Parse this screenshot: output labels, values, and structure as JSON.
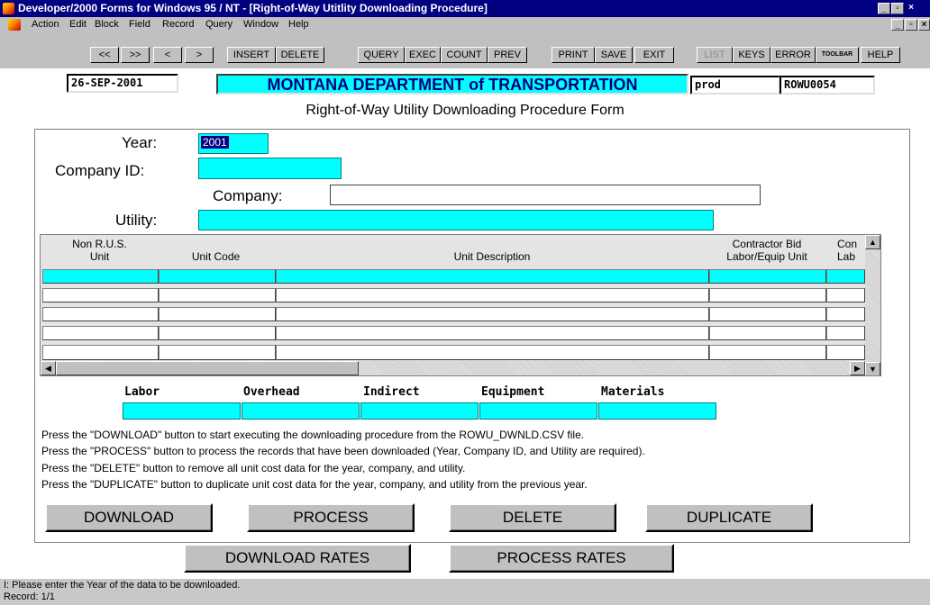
{
  "window": {
    "title": "Developer/2000 Forms for Windows 95 / NT  - [Right-of-Way Utitlity Downloading Procedure]",
    "controls": [
      "_",
      "▫",
      "×"
    ]
  },
  "menu": {
    "items": [
      "Action",
      "Edit",
      "Block",
      "Field",
      "Record",
      "Query",
      "Window",
      "Help"
    ],
    "mdi_controls": [
      "_",
      "▫",
      "×"
    ]
  },
  "toolbar": {
    "buttons": [
      {
        "label": "<<",
        "enabled": true
      },
      {
        "label": ">>",
        "enabled": true
      },
      {
        "label": "<",
        "enabled": true
      },
      {
        "label": ">",
        "enabled": true
      },
      {
        "label": "INSERT",
        "enabled": true
      },
      {
        "label": "DELETE",
        "enabled": true
      },
      {
        "label": "QUERY",
        "enabled": true
      },
      {
        "label": "EXEC",
        "enabled": true
      },
      {
        "label": "COUNT",
        "enabled": true
      },
      {
        "label": "PREV",
        "enabled": true
      },
      {
        "label": "PRINT",
        "enabled": true
      },
      {
        "label": "SAVE",
        "enabled": true
      },
      {
        "label": "EXIT",
        "enabled": true
      },
      {
        "label": "LIST",
        "enabled": false
      },
      {
        "label": "KEYS",
        "enabled": true
      },
      {
        "label": "ERROR",
        "enabled": true
      },
      {
        "label": "TOOLBAR",
        "enabled": true
      },
      {
        "label": "HELP",
        "enabled": true
      }
    ]
  },
  "header": {
    "date": "26-SEP-2001",
    "agency": "MONTANA DEPARTMENT of TRANSPORTATION",
    "database": "prod",
    "form_id": "ROWU0054",
    "form_title": "Right-of-Way Utility Downloading Procedure Form"
  },
  "fields": {
    "year_label": "Year:",
    "year_value": "2001",
    "company_id_label": "Company ID:",
    "company_id_value": "",
    "company_label": "Company:",
    "company_value": "",
    "utility_label": "Utility:",
    "utility_value": ""
  },
  "grid": {
    "columns": [
      {
        "line1": "Non R.U.S.",
        "line2": "Unit"
      },
      {
        "line1": "",
        "line2": "Unit Code"
      },
      {
        "line1": "",
        "line2": "Unit Description"
      },
      {
        "line1": "Contractor Bid",
        "line2": "Labor/Equip Unit"
      },
      {
        "line1": "Con",
        "line2": "Lab"
      }
    ],
    "rows": [
      [
        "",
        "",
        "",
        "",
        ""
      ],
      [
        "",
        "",
        "",
        "",
        ""
      ],
      [
        "",
        "",
        "",
        "",
        ""
      ],
      [
        "",
        "",
        "",
        "",
        ""
      ],
      [
        "",
        "",
        "",
        "",
        ""
      ]
    ]
  },
  "totals": {
    "labels": [
      "Labor",
      "Overhead",
      "Indirect",
      "Equipment",
      "Materials"
    ],
    "values": [
      "",
      "",
      "",
      "",
      ""
    ]
  },
  "instructions": [
    "Press the \"DOWNLOAD\" button to start executing the downloading procedure from the ROWU_DWNLD.CSV file.",
    "Press the \"PROCESS\" button to process the records that have been downloaded (Year, Company ID, and Utility are required).",
    "Press the \"DELETE\" button to remove all unit cost data for the year, company, and utility.",
    "Press the \"DUPLICATE\" button to duplicate unit cost data for the year, company, and utility from the previous year."
  ],
  "actions": {
    "download": "DOWNLOAD",
    "process": "PROCESS",
    "delete": "DELETE",
    "duplicate": "DUPLICATE",
    "download_rates": "DOWNLOAD RATES",
    "process_rates": "PROCESS RATES"
  },
  "status": {
    "message": "I:  Please enter the Year of the data to be downloaded.",
    "record": "Record: 1/1"
  },
  "colors": {
    "title_bar": "#000080",
    "field_cyan": "#00ffff",
    "chrome_gray": "#c0c0c0",
    "banner_text": "#000080"
  }
}
